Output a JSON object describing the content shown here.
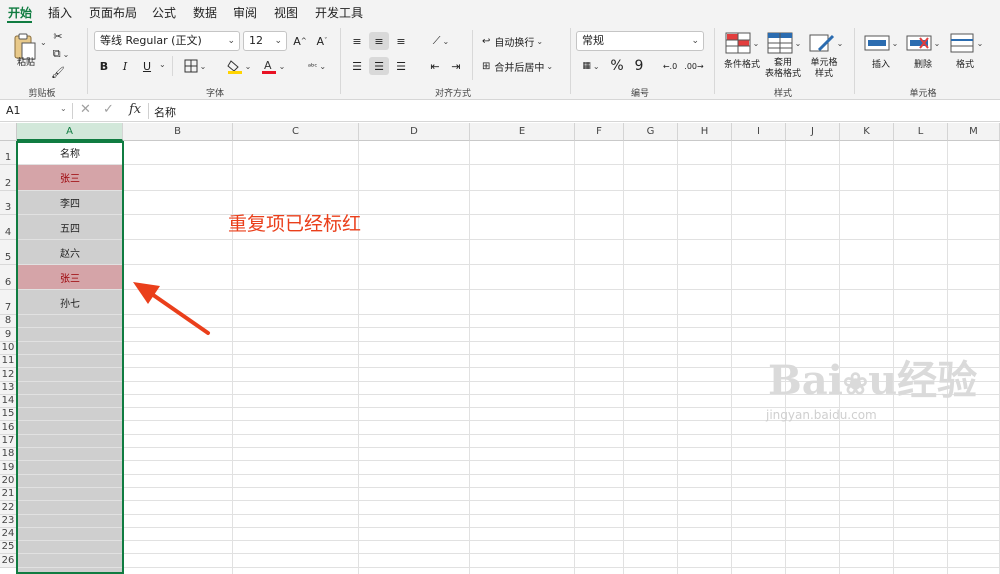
{
  "ribbon_tabs": [
    "开始",
    "插入",
    "页面布局",
    "公式",
    "数据",
    "审阅",
    "视图",
    "开发工具"
  ],
  "clipboard": {
    "paste": "粘贴",
    "group": "剪贴板"
  },
  "font": {
    "name": "等线 Regular (正文)",
    "size": "12",
    "bold": "B",
    "italic": "I",
    "underline": "U",
    "group": "字体",
    "font_color": "#e81123",
    "fill_color": "#ffd400"
  },
  "alignment": {
    "wrap": "自动换行",
    "merge": "合并后居中",
    "group": "对齐方式"
  },
  "number": {
    "format": "常规",
    "percent": "%",
    "comma": "9",
    "group": "编号"
  },
  "styles": {
    "conditional": "条件格式",
    "table_format": [
      "套用",
      "表格格式"
    ],
    "cell_styles": [
      "单元格",
      "样式"
    ],
    "group": "样式"
  },
  "cells": {
    "insert": "插入",
    "delete": "删除",
    "format": "格式",
    "group": "单元格"
  },
  "formula_bar": {
    "name_box": "A1",
    "fx": "fx",
    "content": "名称"
  },
  "columns": [
    "A",
    "B",
    "C",
    "D",
    "E",
    "F",
    "G",
    "H",
    "I",
    "J",
    "K",
    "L",
    "M"
  ],
  "rows": [
    "1",
    "2",
    "3",
    "4",
    "5",
    "6",
    "7",
    "8",
    "9",
    "10",
    "11",
    "12",
    "13",
    "14",
    "15",
    "16",
    "17",
    "18",
    "19",
    "20",
    "21",
    "22",
    "23",
    "24",
    "25",
    "26"
  ],
  "column_a": [
    "名称",
    "张三",
    "李四",
    "五四",
    "赵六",
    "张三",
    "孙七"
  ],
  "duplicate_rows": [
    2,
    6
  ],
  "annotation": "重复项已经标红",
  "accent_color": "#107c41",
  "watermark": {
    "logo": "Bai 经验",
    "url": "jingyan.baidu.com"
  }
}
